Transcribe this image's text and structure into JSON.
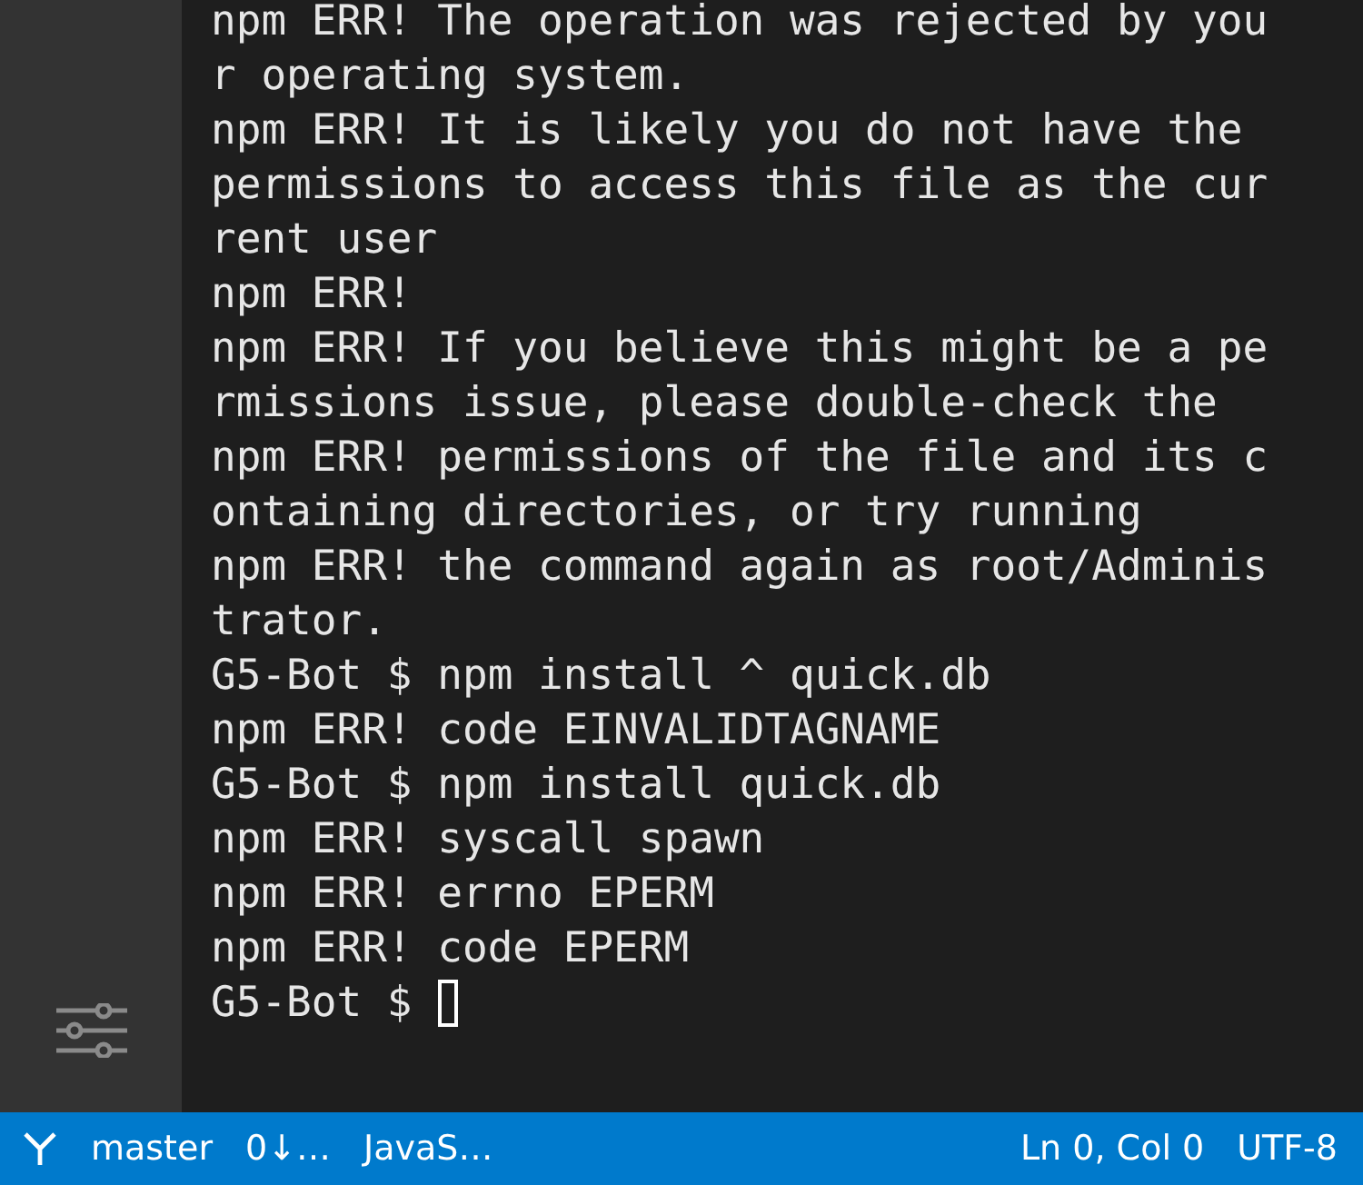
{
  "terminal": {
    "lines": [
      "npm ERR! The operation was rejected by you",
      "r operating system.",
      "npm ERR! It is likely you do not have the",
      "permissions to access this file as the cur",
      "rent user",
      "npm ERR!",
      "npm ERR! If you believe this might be a pe",
      "rmissions issue, please double-check the",
      "npm ERR! permissions of the file and its c",
      "ontaining directories, or try running",
      "npm ERR! the command again as root/Adminis",
      "trator.",
      "G5-Bot $ npm install ^ quick.db",
      "npm ERR! code EINVALIDTAGNAME",
      "G5-Bot $ npm install quick.db",
      "npm ERR! syscall spawn",
      "npm ERR! errno EPERM",
      "npm ERR! code EPERM"
    ],
    "prompt": "G5-Bot $"
  },
  "status_bar": {
    "branch": "master",
    "sync": "0↓…",
    "language": "JavaS…",
    "position": "Ln 0, Col 0",
    "encoding": "UTF-8"
  }
}
